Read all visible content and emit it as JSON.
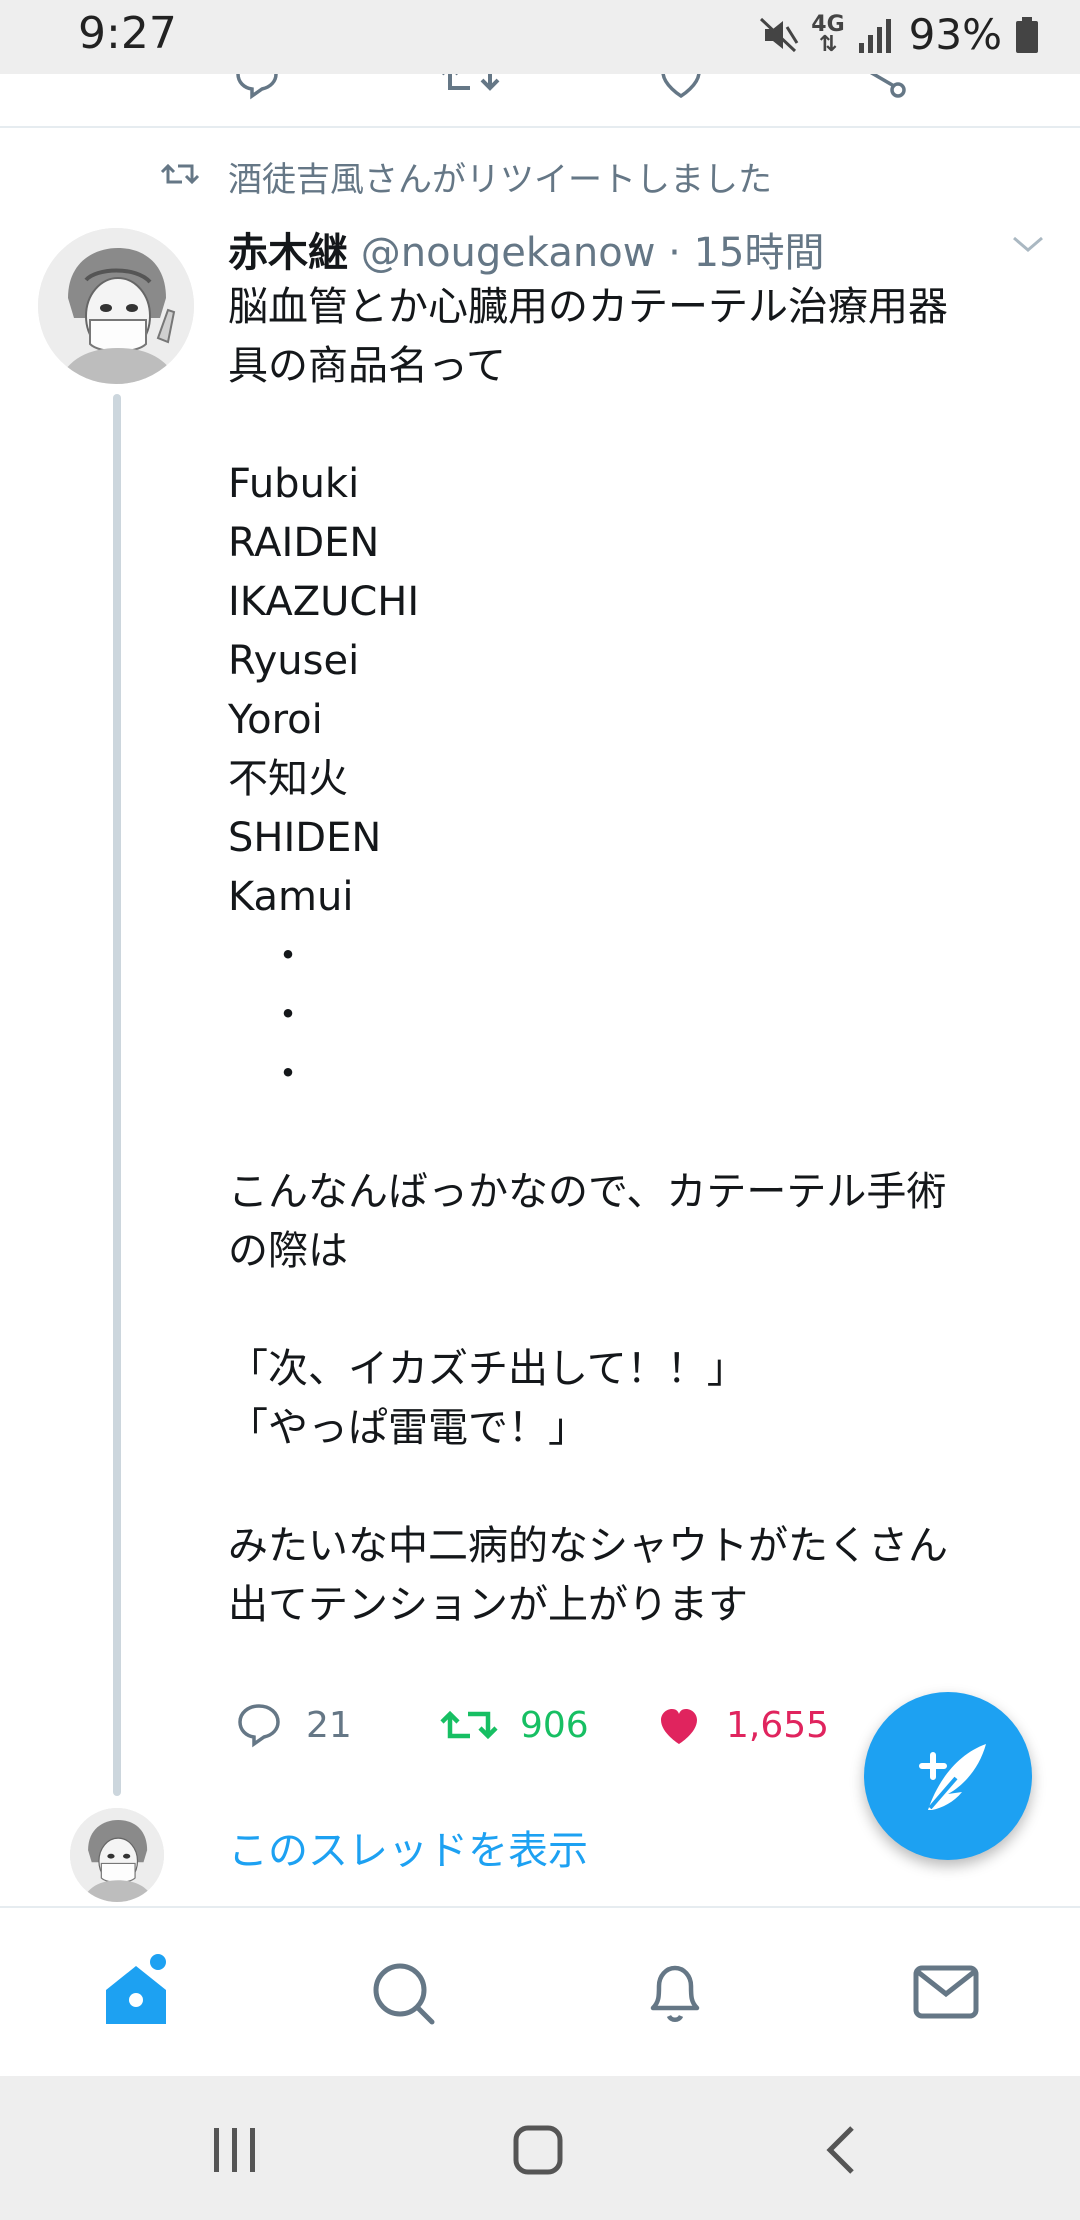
{
  "status_bar": {
    "time": "9:27",
    "network": "4G",
    "battery": "93%"
  },
  "retweet_context": "酒徒吉風さんがリツイートしました",
  "tweet": {
    "display_name": "赤木継",
    "handle": "@nougekanow",
    "separator": "·",
    "time_ago": "15時間",
    "lines": [
      "脳血管とか心臓用のカテーテル治療用器",
      "具の商品名って",
      "",
      "Fubuki",
      "RAIDEN",
      "IKAZUCHI",
      "Ryusei",
      "Yoroi",
      "不知火",
      "SHIDEN",
      "Kamui",
      "　・",
      "　・",
      "　・",
      "",
      "こんなんばっかなので、カテーテル手術",
      "の際は",
      "",
      "「次、イカズチ出して！！」",
      "「やっぱ雷電で！」",
      "",
      "みたいな中二病的なシャウトがたくさん",
      "出てテンションが上がります"
    ],
    "reply_count": "21",
    "retweet_count": "906",
    "like_count": "1,655"
  },
  "show_thread_label": "このスレッドを表示",
  "colors": {
    "accent": "#1da1f2",
    "retweet": "#17bf63",
    "like": "#e0245e",
    "muted": "#657786"
  },
  "icons": [
    "reply-icon",
    "retweet-icon",
    "heart-icon",
    "compose-icon",
    "home-icon",
    "search-icon",
    "bell-icon",
    "mail-icon"
  ]
}
